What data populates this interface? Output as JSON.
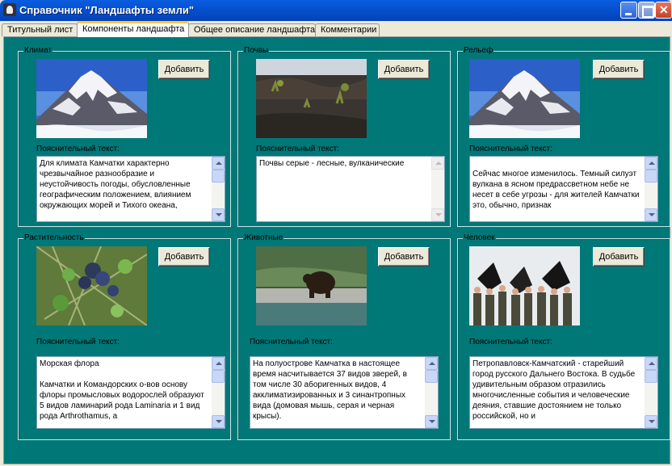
{
  "window": {
    "title": "Справочник \"Ландшафты земли\""
  },
  "tabs": [
    {
      "label": "Титульный лист"
    },
    {
      "label": "Компоненты ландшафта"
    },
    {
      "label": "Общее описание ландшафта"
    },
    {
      "label": "Комментарии"
    }
  ],
  "panels": [
    {
      "title": "Климат",
      "add_label": "Добавить",
      "text_label": "Пояснительный текст:",
      "image": "volcano-photo",
      "text": "Для климата Камчатки характерно чрезвычайное разнообразие и неустойчивость погоды, обусловленные географическим положением, влиянием окружающих морей и Тихого океана,"
    },
    {
      "title": "Почвы",
      "add_label": "Добавить",
      "text_label": "Пояснительный текст:",
      "image": "soil-photo",
      "text": "Почвы серые - лесные, вулканические"
    },
    {
      "title": "Рельеф",
      "add_label": "Добавить",
      "text_label": "Пояснительный текст:",
      "image": "volcano-photo",
      "text": "\nСейчас многое изменилось. Темный силуэт вулкана в ясном предрассветном небе не несет в себе угрозы - для жителей Камчатки это, обычно, признак"
    },
    {
      "title": "Растительность",
      "add_label": "Добавить",
      "text_label": "Пояснительный текст:",
      "image": "vegetation-photo",
      "text": "Морская флора\n\nКамчатки и Командорских о-вов основу флоры промысловых водорослей образуют 5 видов ламинарий рода Laminaria и 1 вид рода Arthrothamus, а"
    },
    {
      "title": "Животные",
      "add_label": "Добавить",
      "text_label": "Пояснительный текст:",
      "image": "bear-photo",
      "text": "На полуострове Камчатка в настоящее время насчитывается 37 видов зверей, в том числе 30 аборигенных видов, 4 акклиматизированных и 3 синантропных вида (домовая мышь, серая и черная крысы)."
    },
    {
      "title": "Человек",
      "add_label": "Добавить",
      "text_label": "Пояснительный текст:",
      "image": "hunters-photo",
      "text": "Петропавловск-Камчатский - старейший город русского Дальнего Востока. В судьбе удивительным образом отразились многочисленные события и человеческие деяния, ставшие достоянием не только российской, но и"
    }
  ],
  "colors": {
    "background": "#007878",
    "titlebar": "#0552d0",
    "tab_highlight": "#ffc83c"
  }
}
